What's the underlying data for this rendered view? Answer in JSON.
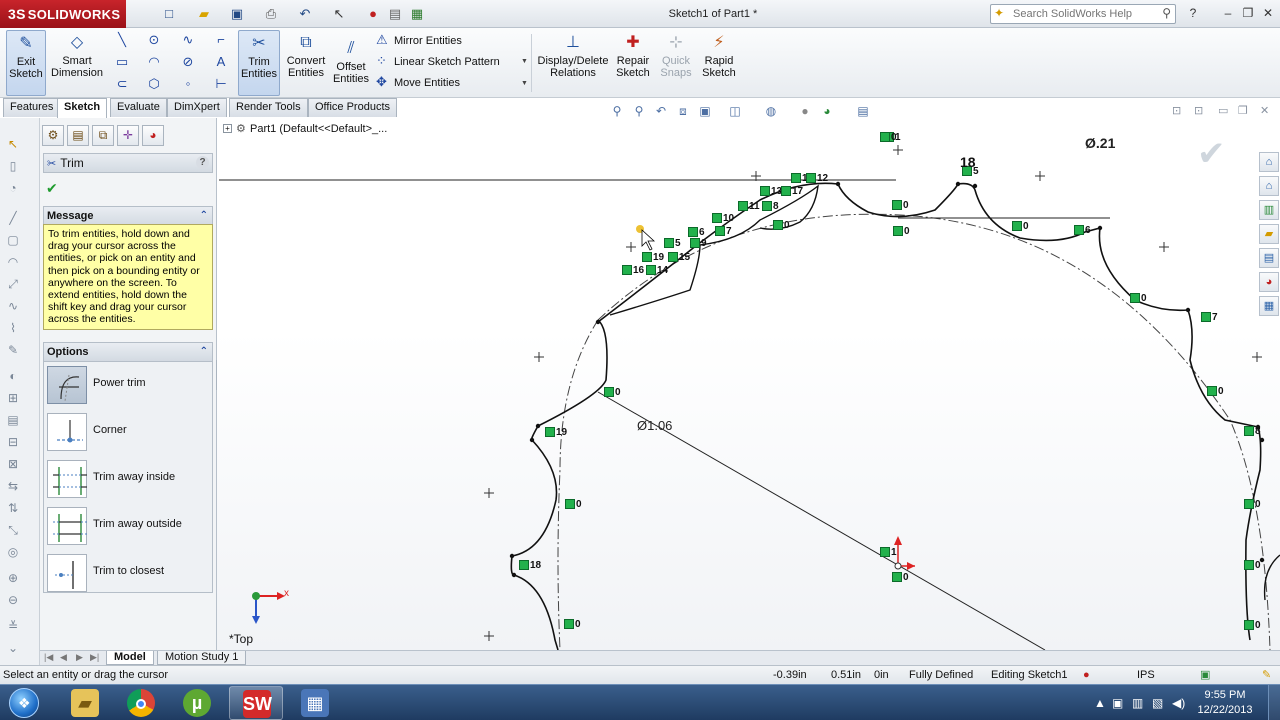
{
  "app": {
    "brand": "SOLIDWORKS",
    "doc_title": "Sketch1 of Part1 *",
    "help_search_placeholder": "Search SolidWorks Help"
  },
  "commands": {
    "exit_sketch": "Exit\nSketch",
    "smart_dimension": "Smart\nDimension",
    "trim_entities": "Trim\nEntities",
    "convert_entities": "Convert\nEntities",
    "offset_entities": "Offset\nEntities",
    "mirror_entities": "Mirror Entities",
    "linear_sketch_pattern": "Linear Sketch Pattern",
    "move_entities": "Move Entities",
    "display_delete_relations": "Display/Delete\nRelations",
    "repair_sketch": "Repair\nSketch",
    "quick_snaps": "Quick\nSnaps",
    "rapid_sketch": "Rapid\nSketch"
  },
  "tabs": [
    "Features",
    "Sketch",
    "Evaluate",
    "DimXpert",
    "Render Tools",
    "Office Products"
  ],
  "active_tab": "Sketch",
  "property_manager": {
    "title": "Trim",
    "message_header": "Message",
    "message_text": "To trim entities, hold down and drag your cursor across the entities, or pick on an entity and then pick on a bounding entity or anywhere on the screen.  To extend entities, hold down the shift key and drag your cursor across the entities.",
    "options_header": "Options",
    "options": [
      {
        "label": "Power trim",
        "icon": "power-trim-icon",
        "selected": true
      },
      {
        "label": "Corner",
        "icon": "corner-icon",
        "selected": false
      },
      {
        "label": "Trim away inside",
        "icon": "trim-away-inside-icon",
        "selected": false
      },
      {
        "label": "Trim away outside",
        "icon": "trim-away-outside-icon",
        "selected": false
      },
      {
        "label": "Trim to closest",
        "icon": "trim-to-closest-icon",
        "selected": false
      }
    ]
  },
  "graphics": {
    "feature_tree_root": "Part1  (Default<<Default>_...",
    "dimension_large": "Ø1.06",
    "dimension_small": "Ø.21",
    "tooth_count_label": "18",
    "view_orientation": "*Top",
    "axis_x": "x",
    "relation_numbers": [
      "1",
      "18",
      "12",
      "13",
      "17",
      "11",
      "8",
      "10",
      "7",
      "6",
      "9",
      "5",
      "19",
      "15",
      "16",
      "14",
      "0",
      "0",
      "0",
      "0",
      "0",
      "0",
      "0",
      "0",
      "0",
      "6",
      "5",
      "7",
      "0",
      "8",
      "0",
      "19",
      "0",
      "18",
      "0",
      "0",
      "1"
    ]
  },
  "model_tabs": [
    "Model",
    "Motion Study 1"
  ],
  "active_model_tab": "Model",
  "status": {
    "prompt": "Select an entity or drag the cursor",
    "x": "-0.39in",
    "y": "0.51in",
    "z": "0in",
    "state": "Fully Defined",
    "editing": "Editing Sketch1",
    "units": "IPS"
  },
  "taskbar": {
    "time": "9:55 PM",
    "date": "12/22/2013"
  },
  "colors": {
    "brand_red": "#c8242b",
    "relation_green": "#22b14c",
    "message_yellow": "#ffffa6",
    "taskbar_blue": "#2a4a74"
  }
}
